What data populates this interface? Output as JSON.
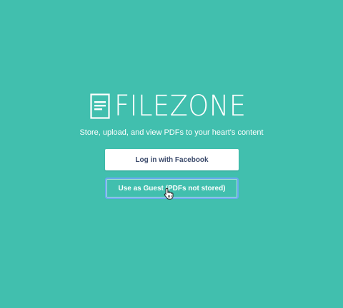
{
  "brand": {
    "name": "FILEZONE",
    "icon": "document-icon",
    "tagline": "Store, upload, and view PDFs to your heart's content"
  },
  "actions": {
    "facebook_login_label": "Log in with Facebook",
    "guest_label": "Use as Guest (PDFs not stored)"
  },
  "pointer": {
    "icon": "hand-pointer-icon"
  },
  "colors": {
    "background": "#41bfae",
    "text": "#ffffff",
    "facebook_button_text": "#3b4a6b",
    "focus_ring": "#6aa8f0"
  }
}
